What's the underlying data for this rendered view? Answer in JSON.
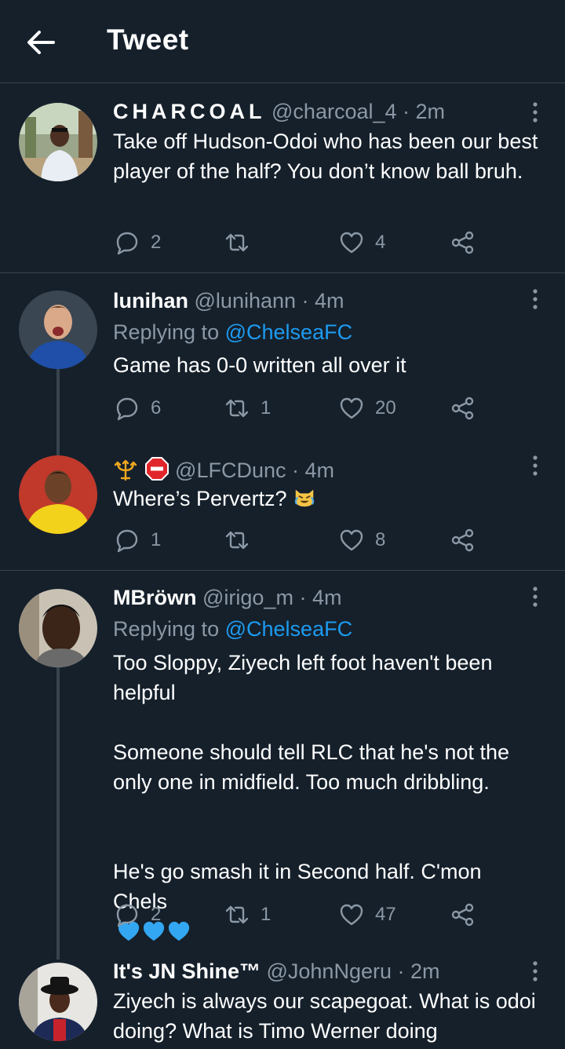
{
  "header": {
    "title": "Tweet",
    "back_icon": "arrow-left-icon"
  },
  "colors": {
    "background": "#15202b",
    "accent": "#1d9bf0",
    "muted": "#8b98a5",
    "divider": "#38444d"
  },
  "tweets": [
    {
      "name": "CHARCOAL",
      "handle": "@charcoal_4",
      "time": "· 2m",
      "text": "Take off Hudson-Odoi who has been our best player of the half? You don’t know ball bruh.",
      "replies": "2",
      "retweets": "",
      "likes": "4"
    },
    {
      "name": "lunihan",
      "handle": "@lunihann",
      "time": "· 4m",
      "replying_label": "Replying to",
      "replying_to": "@ChelseaFC",
      "text": "Game has 0-0 written all over it",
      "replies": "6",
      "retweets": "1",
      "likes": "20"
    },
    {
      "name_icons": [
        "trident-icon",
        "stop-sign-icon"
      ],
      "handle": "@LFCDunc",
      "time": "· 4m",
      "text": "Where’s Pervertz?",
      "text_emoji": "crying-laughing-cat-icon",
      "replies": "1",
      "retweets": "",
      "likes": "8"
    },
    {
      "name": "MBröwn",
      "handle": "@irigo_m",
      "time": "· 4m",
      "replying_label": "Replying to",
      "replying_to": "@ChelseaFC",
      "text_p1": "Too Sloppy, Ziyech left foot haven't been helpful",
      "text_p2": "Someone should tell RLC that he's not the only one in midfield. Too much dribbling.",
      "text_p3": "He's go smash it in Second half. C'mon Chels",
      "text_emoji": "blue-heart-icon",
      "replies": "2",
      "retweets": "1",
      "likes": "47"
    },
    {
      "name": "It's JN Shine™",
      "handle": "@JohnNgeru",
      "time": "· 2m",
      "text": "Ziyech is always our scapegoat. What is odoi doing? What is Timo Werner doing"
    }
  ]
}
